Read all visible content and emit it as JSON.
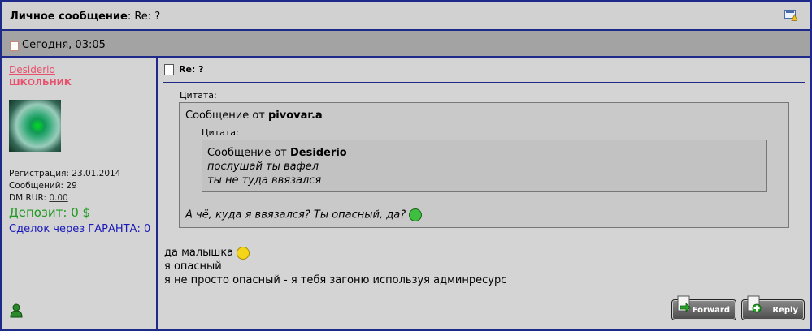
{
  "header": {
    "title_bold": "Личное сообщение",
    "title_rest": ": Re: ?"
  },
  "date": "Сегодня, 03:05",
  "user": {
    "name": "Desiderio",
    "title": "ШКОЛЬНИК",
    "registration": "Регистрация: 23.01.2014",
    "messages": "Сообщений: 29",
    "dm_label": "DM RUR:",
    "dm_value": "0.00",
    "deposit": "Депозит: 0 $",
    "garant": "Сделок через ГАРАНТА: 0"
  },
  "message": {
    "subject": "Re: ?",
    "outer_quote": {
      "label": "Цитата:",
      "from_prefix": "Сообщение от",
      "from_name": "pivovar.a",
      "inner_quote": {
        "label": "Цитата:",
        "from_prefix": "Сообщение от",
        "from_name": "Desiderio",
        "lines": [
          "послушай ты вафел",
          "ты не туда ввязался"
        ]
      },
      "reply": "А чё, куда я ввязался? Ты опасный, да?"
    },
    "body": [
      "да малышка",
      "я опасный",
      "я не просто опасный - я тебя загоню используя админресурс"
    ]
  },
  "buttons": {
    "forward": "Forward",
    "reply": "Reply"
  },
  "icons": [
    "report-icon",
    "doc-icon",
    "post-icon",
    "user-online-icon",
    "smile-icon",
    "grin-icon",
    "forward-icon",
    "reply-icon"
  ]
}
